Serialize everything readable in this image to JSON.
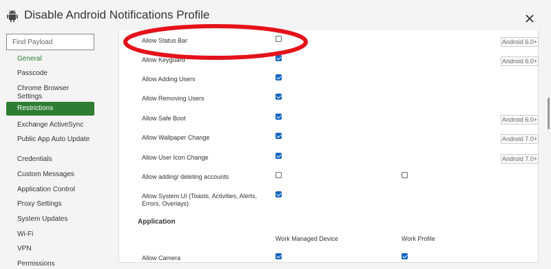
{
  "header": {
    "title": "Disable Android Notifications Profile",
    "platform_icon": "android-icon",
    "close_icon": "close-icon"
  },
  "sidebar": {
    "search_placeholder": "Find Payload",
    "items": [
      {
        "label": "General",
        "state": "green"
      },
      {
        "label": "Passcode"
      },
      {
        "label": "Chrome Browser Settings"
      },
      {
        "label": "Restrictions",
        "state": "active"
      },
      {
        "label": "Exchange ActiveSync"
      },
      {
        "label": "Public App Auto Update"
      },
      {
        "label": "Credentials"
      },
      {
        "label": "Custom Messages"
      },
      {
        "label": "Application Control"
      },
      {
        "label": "Proxy Settings"
      },
      {
        "label": "System Updates"
      },
      {
        "label": "Wi-Fi"
      },
      {
        "label": "VPN"
      },
      {
        "label": "Permissions"
      }
    ]
  },
  "restrictions": {
    "rows": [
      {
        "label": "Allow Status Bar",
        "checked": false,
        "badge": "Android 6.0+"
      },
      {
        "label": "Allow Keyguard",
        "checked": true,
        "badge": "Android 6.0+"
      },
      {
        "label": "Allow Adding Users",
        "checked": true
      },
      {
        "label": "Allow Removing Users",
        "checked": true
      },
      {
        "label": "Allow Safe Boot",
        "checked": true,
        "badge": "Android 6.0+"
      },
      {
        "label": "Allow Wallpaper Change",
        "checked": true,
        "badge": "Android 7.0+"
      },
      {
        "label": "Allow User Icon Change",
        "checked": true,
        "badge": "Android 7.0+"
      },
      {
        "label": "Allow adding/ deleting accounts",
        "checked": false,
        "checked_work_profile": false
      },
      {
        "label": "Allow System UI (Toasts, Activities, Alerts, Errors, Overlays)",
        "checked": true
      }
    ],
    "application": {
      "title": "Application",
      "col_work_managed": "Work Managed Device",
      "col_work_profile": "Work Profile",
      "rows": [
        {
          "label": "Allow Camera",
          "checked_managed": true,
          "checked_profile": true
        }
      ]
    }
  },
  "colors": {
    "accent_green": "#2e7d32",
    "checkbox_blue": "#1565c0",
    "annotation_red": "#e5121b"
  }
}
